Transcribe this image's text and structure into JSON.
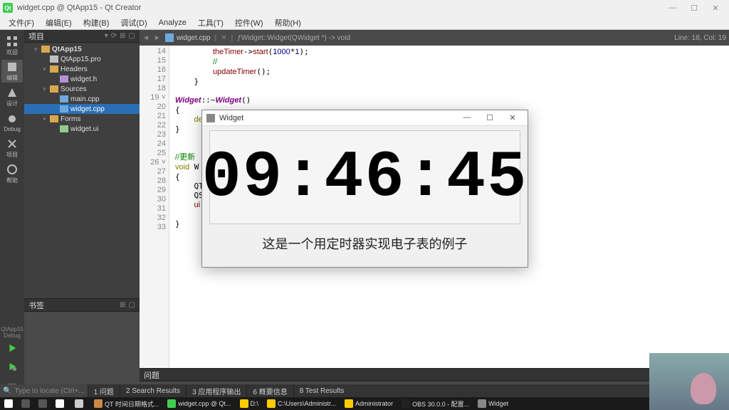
{
  "titlebar": {
    "title": "widget.cpp @ QtApp15 - Qt Creator"
  },
  "menu": [
    "文件(F)",
    "编辑(E)",
    "构建(B)",
    "调试(D)",
    "Analyze",
    "工具(T)",
    "控件(W)",
    "帮助(H)"
  ],
  "strip": {
    "items": [
      {
        "label": "欢迎"
      },
      {
        "label": "编辑"
      },
      {
        "label": "设计"
      },
      {
        "label": "Debug"
      },
      {
        "label": "项目"
      },
      {
        "label": "帮助"
      }
    ],
    "bottom_group_label": "QtApp15",
    "debug_label": "Debug"
  },
  "project_panel": {
    "title": "项目"
  },
  "tree": [
    {
      "level": 1,
      "icon": "folder",
      "label": "QtApp15",
      "exp": true,
      "bold": true
    },
    {
      "level": 2,
      "icon": "profile",
      "label": "QtApp15.pro"
    },
    {
      "level": 2,
      "icon": "folder",
      "label": "Headers",
      "exp": true
    },
    {
      "level": 3,
      "icon": "hfile",
      "label": "widget.h"
    },
    {
      "level": 2,
      "icon": "folder",
      "label": "Sources",
      "exp": true
    },
    {
      "level": 3,
      "icon": "cfile",
      "label": "main.cpp"
    },
    {
      "level": 3,
      "icon": "cfile",
      "label": "widget.cpp",
      "sel": true
    },
    {
      "level": 2,
      "icon": "folder",
      "label": "Forms",
      "exp": true
    },
    {
      "level": 3,
      "icon": "uifile",
      "label": "widget.ui"
    }
  ],
  "editor": {
    "tab_file": "widget.cpp",
    "func_sig": "Widget::Widget(QWidget *) -> void",
    "cursor": "Line: 18, Col: 19",
    "lines_start": 14,
    "lines_end": 33,
    "fold_lines": [
      19,
      26
    ],
    "code": [
      "        theTimer->start(1000*1);",
      "        //",
      "        updateTimer();",
      "    }",
      "",
      "Widget::~Widget()",
      "{",
      "    delete ui;",
      "}",
      "",
      "",
      "//更新",
      "void W",
      "{",
      "    QT",
      "    QS",
      "    ui",
      "",
      "}",
      ""
    ]
  },
  "panels": {
    "issues": "问题",
    "bookmarks": "书签"
  },
  "bottom": {
    "locate_placeholder": "Type to locate (Ctrl+...",
    "results": [
      "1 问题",
      "2 Search Results",
      "3 应用程序输出",
      "6 概要信息",
      "8 Test Results"
    ]
  },
  "taskbar": {
    "items": [
      {
        "color": "#fff",
        "label": ""
      },
      {
        "color": "#ccc",
        "label": ""
      },
      {
        "color": "#c84",
        "label": "QT 时间日期格式..."
      },
      {
        "color": "#41cd52",
        "label": "widget.cpp @ Qt..."
      },
      {
        "color": "#ffcc00",
        "label": "D:\\"
      },
      {
        "color": "#ffcc00",
        "label": "C:\\Users\\Administr..."
      },
      {
        "color": "#ffcc00",
        "label": "Administrator"
      },
      {
        "color": "#222",
        "label": "OBS 30.0.0 - 配置..."
      },
      {
        "color": "#888",
        "label": "Widget"
      }
    ]
  },
  "appwin": {
    "title": "Widget",
    "time": "09:46:45",
    "caption": "这是一个用定时器实现电子表的例子"
  }
}
